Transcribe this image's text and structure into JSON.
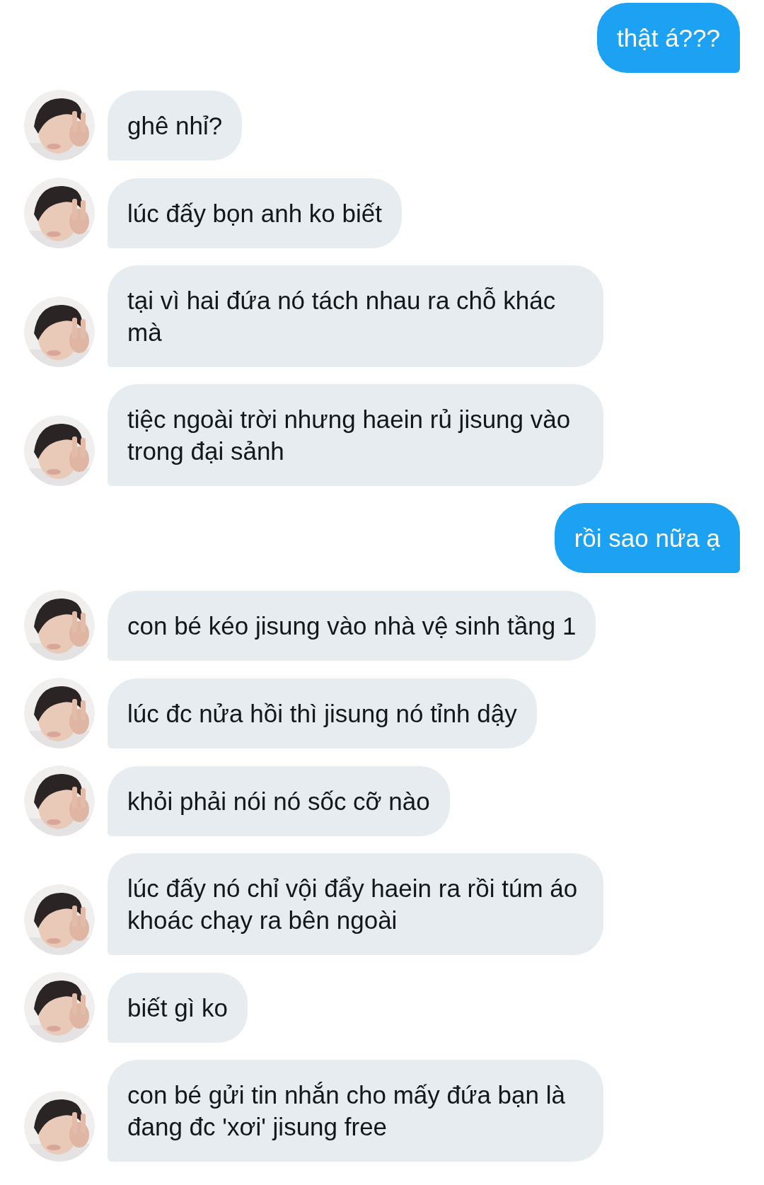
{
  "messages": [
    {
      "kind": "sent",
      "text": "thật á???"
    },
    {
      "kind": "received",
      "text": "ghê nhỉ?"
    },
    {
      "kind": "received",
      "text": "lúc đấy bọn anh ko biết"
    },
    {
      "kind": "received",
      "text": "tại vì hai đứa nó tách nhau ra chỗ khác mà"
    },
    {
      "kind": "received",
      "text": "tiệc ngoài trời nhưng haein rủ jisung vào trong đại sảnh"
    },
    {
      "kind": "sent",
      "text": "rồi sao nữa ạ"
    },
    {
      "kind": "received",
      "text": "con bé kéo jisung vào nhà vệ sinh tầng 1"
    },
    {
      "kind": "received",
      "text": "lúc đc nửa hồi thì jisung nó tỉnh dậy"
    },
    {
      "kind": "received",
      "text": "khỏi phải nói nó sốc cỡ nào"
    },
    {
      "kind": "received",
      "text": "lúc đấy nó chỉ vội đẩy haein ra rồi túm áo khoác chạy ra bên ngoài"
    },
    {
      "kind": "received",
      "text": "biết gì ko"
    },
    {
      "kind": "received",
      "text": "con bé gửi tin nhắn cho mấy đứa bạn là đang đc 'xơi' jisung free"
    }
  ]
}
